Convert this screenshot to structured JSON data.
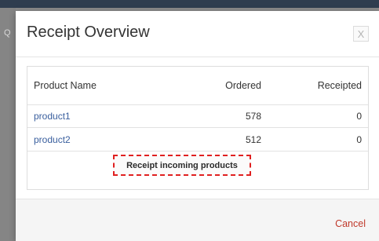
{
  "background": {
    "icon": "search-icon",
    "icon_glyph": "Q"
  },
  "modal": {
    "title": "Receipt Overview",
    "close_glyph": "X",
    "table": {
      "headers": {
        "name": "Product Name",
        "ordered": "Ordered",
        "receipted": "Receipted"
      },
      "rows": [
        {
          "name": "product1",
          "ordered": "578",
          "receipted": "0"
        },
        {
          "name": "product2",
          "ordered": "512",
          "receipted": "0"
        }
      ],
      "action_label": "Receipt incoming products"
    },
    "footer": {
      "cancel_label": "Cancel"
    }
  },
  "colors": {
    "link": "#3a5f9e",
    "cancel": "#c0392b",
    "highlight": "#e02020"
  }
}
